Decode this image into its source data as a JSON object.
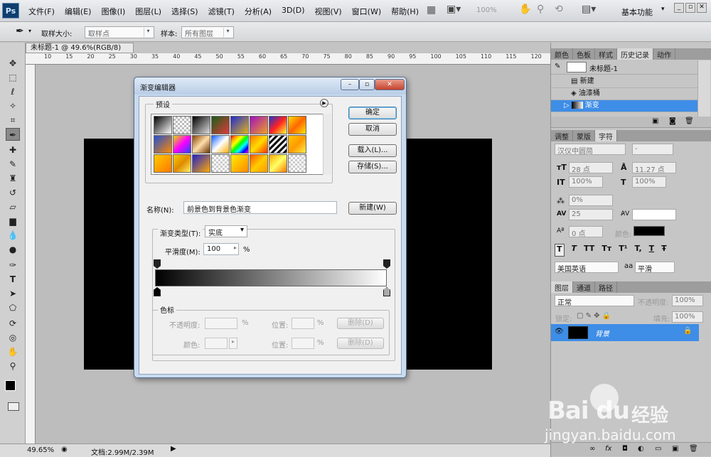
{
  "app": {
    "logo": "Ps"
  },
  "menu": [
    "文件(F)",
    "编辑(E)",
    "图像(I)",
    "图层(L)",
    "选择(S)",
    "滤镜(T)",
    "分析(A)",
    "3D(D)",
    "视图(V)",
    "窗口(W)",
    "帮助(H)"
  ],
  "appbar": {
    "zoom": "100%",
    "workspace": "基本功能"
  },
  "options": {
    "sample_size_label": "取样大小:",
    "sample_size_value": "取样点",
    "sample_label": "样本:",
    "sample_value": "所有图层"
  },
  "document": {
    "tab_title": "未标题-1 @ 49.6%(RGB/8) *",
    "ruler_ticks": [
      "10",
      "15",
      "20",
      "25",
      "30",
      "35",
      "40",
      "45",
      "50",
      "55",
      "60",
      "65",
      "70",
      "75",
      "80",
      "85",
      "90",
      "95",
      "100",
      "105",
      "110",
      "115",
      "120"
    ]
  },
  "status": {
    "zoom": "49.65%",
    "doc_info": "文档:2.99M/2.39M"
  },
  "dialog": {
    "title": "渐变编辑器",
    "presets_label": "预设",
    "ok": "确定",
    "cancel": "取消",
    "load": "载入(L)...",
    "save": "存储(S)...",
    "name_label": "名称(N):",
    "name_value": "前景色到背景色渐变",
    "new": "新建(W)",
    "type_label": "渐变类型(T):",
    "type_value": "实底",
    "smooth_label": "平滑度(M):",
    "smooth_value": "100",
    "smooth_unit": "%",
    "stops_label": "色标",
    "opacity_label": "不透明度:",
    "opacity_unit": "%",
    "position_label": "位置:",
    "position_unit": "%",
    "delete": "删除(D)",
    "color_label": "颜色:",
    "preset_swatches": [
      "linear-gradient(135deg,#000,#fff)",
      "repeating-conic-gradient(#bbb 0 25%,#fff 0 50%) 0 0/6px 6px",
      "linear-gradient(135deg,#000,#ddd)",
      "linear-gradient(135deg,#1a5d1a,#e23b3b)",
      "linear-gradient(135deg,#1e2bd1,#e2b21a)",
      "linear-gradient(135deg,#a010c0,#f0a020)",
      "linear-gradient(135deg,#2233cc,#ff2222,#ffff33)",
      "linear-gradient(135deg,#ffdd00,#ff6600,#ffe600)",
      "linear-gradient(135deg,#2050d0,#ff8800)",
      "linear-gradient(135deg,#e0e000,#ff00ff,#2244ff)",
      "linear-gradient(135deg,#884400,#ffddaa,#663300)",
      "linear-gradient(135deg,#1060ff,#ffffff,#ffaa00)",
      "linear-gradient(135deg,red,orange,yellow,lime,cyan,blue,magenta)",
      "linear-gradient(135deg,#ff7700,#ffdd00,#ff3300)",
      "repeating-linear-gradient(135deg,#111 0 3px,#fff 3px 6px)",
      "linear-gradient(135deg,#ffcc00,#ff9900,#ffee44)",
      "linear-gradient(135deg,#ffcc00,#ff7700)",
      "linear-gradient(135deg,#f4d000,#e08a00,#fff066)",
      "linear-gradient(135deg,#2020cc,#ffaa00)",
      "repeating-conic-gradient(#ccc 0 25%,#fff 0 50%) 0 0/6px 6px",
      "linear-gradient(135deg,#ffee00,#ff8800)",
      "linear-gradient(135deg,#ff5500,#ffcc00,#ff9900)",
      "linear-gradient(135deg,#ffaa00,#ffff66,#ff7700)",
      "repeating-conic-gradient(#ccc 0 25%,#fff 0 50%) 0 0/6px 6px"
    ]
  },
  "panels": {
    "top_tabs": [
      "颜色",
      "色板",
      "样式",
      "历史记录",
      "动作"
    ],
    "history_snapshot": "未标题-1",
    "history_items": [
      "新建",
      "油漆桶",
      "渐变"
    ],
    "char_tabs": [
      "调整",
      "蒙版",
      "字符"
    ],
    "font_family": "汉仪中圆简",
    "font_style": "-",
    "font_size": "28 点",
    "leading": "11.27 点",
    "vscale": "100%",
    "hscale": "100%",
    "tracking_pct": "0%",
    "kerning": "25",
    "baseline": "0 点",
    "color_label": "颜色:",
    "type_style_buttons": [
      "T",
      "T",
      "TT",
      "Tт",
      "T¹",
      "T,",
      "T",
      "Ŧ"
    ],
    "language": "美国英语",
    "aa_label": "aa",
    "antialias": "平滑",
    "layer_tabs": [
      "图层",
      "通道",
      "路径"
    ],
    "blend_mode": "正常",
    "opacity_label": "不透明度:",
    "opacity_value": "100%",
    "lock_label": "锁定:",
    "fill_label": "填充:",
    "fill_value": "100%",
    "layer_name": "背景",
    "footer_icons": [
      "link",
      "fx",
      "mask",
      "adjust",
      "folder",
      "new",
      "trash"
    ]
  },
  "watermark": {
    "brand": "Bai du",
    "cn": "经验",
    "url": "jingyan.baidu.com"
  }
}
